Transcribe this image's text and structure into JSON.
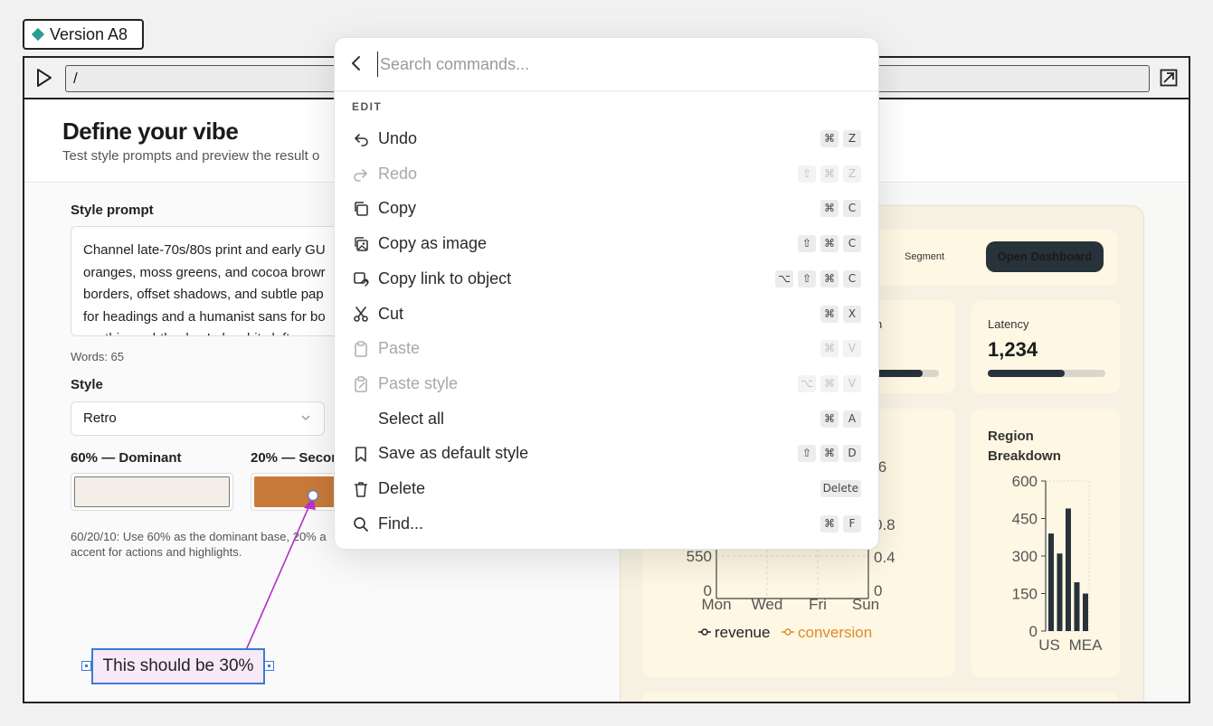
{
  "version_tag": {
    "label": "Version A8"
  },
  "urlbar": {
    "path": "/"
  },
  "page": {
    "title": "Define your vibe",
    "subtitle": "Test style prompts and preview the result o"
  },
  "form": {
    "style_prompt_label": "Style prompt",
    "style_prompt_lines": [
      "Channel late-70s/80s print and early GU",
      "oranges, moss greens, and cocoa browr",
      "borders, offset shadows, and subtle pap",
      "for headings and a humanist sans for bo",
      "anything subtle play Lukes bits left a"
    ],
    "words": "Words: 65",
    "style_label": "Style",
    "style_value": "Retro",
    "dominant_label": "60% — Dominant",
    "secondary_label": "20% — Secor",
    "dominant_color": "#f3efe8",
    "secondary_color": "#c77a3a",
    "hint_line1": "60/20/10: Use 60% as the dominant base, 20% a",
    "hint_line2": "accent for actions and highlights."
  },
  "preview": {
    "segment_label": "Segment",
    "open_dashboard": "Open Dashboard",
    "card2_partial_label": "n",
    "latency_label": "Latency",
    "latency_value": "1,234",
    "latency_progress": 0.65,
    "card2_progress": 0.85,
    "region_title_1": "Region",
    "region_title_2": "Breakdown",
    "line_chart_ticks_left": [
      "550",
      "0"
    ],
    "line_chart_ticks_right": [
      ".6",
      "0.8",
      "0.4",
      "0"
    ],
    "line_chart_days": [
      "Mon",
      "Wed",
      "Fri",
      "Sun"
    ],
    "legend_revenue": "revenue",
    "legend_conversion": "conversion",
    "revenue_color": "#222222",
    "conversion_color": "#e08a2c"
  },
  "chart_data": {
    "type": "bar",
    "categories": [
      "US",
      "",
      "",
      "",
      "MEA"
    ],
    "values": [
      390,
      310,
      490,
      195,
      150
    ],
    "xtick_labels": [
      "US",
      "MEA"
    ],
    "ytick_labels": [
      "600",
      "450",
      "300",
      "150",
      "0"
    ],
    "ylim": [
      0,
      600
    ],
    "bar_color": "#28323a"
  },
  "palette": {
    "placeholder": "Search commands...",
    "section": "EDIT",
    "commands": [
      {
        "label": "Undo",
        "icon": "undo-icon",
        "keys": [
          "⌘",
          "Z"
        ],
        "disabled": false
      },
      {
        "label": "Redo",
        "icon": "redo-icon",
        "keys": [
          "⇧",
          "⌘",
          "Z"
        ],
        "disabled": true
      },
      {
        "label": "Copy",
        "icon": "copy-icon",
        "keys": [
          "⌘",
          "C"
        ],
        "disabled": false
      },
      {
        "label": "Copy as image",
        "icon": "image-icon",
        "keys": [
          "⇧",
          "⌘",
          "C"
        ],
        "disabled": false
      },
      {
        "label": "Copy link to object",
        "icon": "link-icon",
        "keys": [
          "⌥",
          "⇧",
          "⌘",
          "C"
        ],
        "disabled": false
      },
      {
        "label": "Cut",
        "icon": "scissors-icon",
        "keys": [
          "⌘",
          "X"
        ],
        "disabled": false
      },
      {
        "label": "Paste",
        "icon": "clipboard-icon",
        "keys": [
          "⌘",
          "V"
        ],
        "disabled": true
      },
      {
        "label": "Paste style",
        "icon": "paste-style-icon",
        "keys": [
          "⌥",
          "⌘",
          "V"
        ],
        "disabled": true
      },
      {
        "label": "Select all",
        "icon": "",
        "keys": [
          "⌘",
          "A"
        ],
        "disabled": false
      },
      {
        "label": "Save as default style",
        "icon": "bookmark-icon",
        "keys": [
          "⇧",
          "⌘",
          "D"
        ],
        "disabled": false
      },
      {
        "label": "Delete",
        "icon": "trash-icon",
        "keys": [
          "Delete"
        ],
        "disabled": false
      },
      {
        "label": "Find...",
        "icon": "search-icon",
        "keys": [
          "⌘",
          "F"
        ],
        "disabled": false
      }
    ]
  },
  "annotation": {
    "text": "This should be 30%",
    "color": "#b52fc9"
  },
  "arrow": {
    "color": "#2a9d8f"
  }
}
